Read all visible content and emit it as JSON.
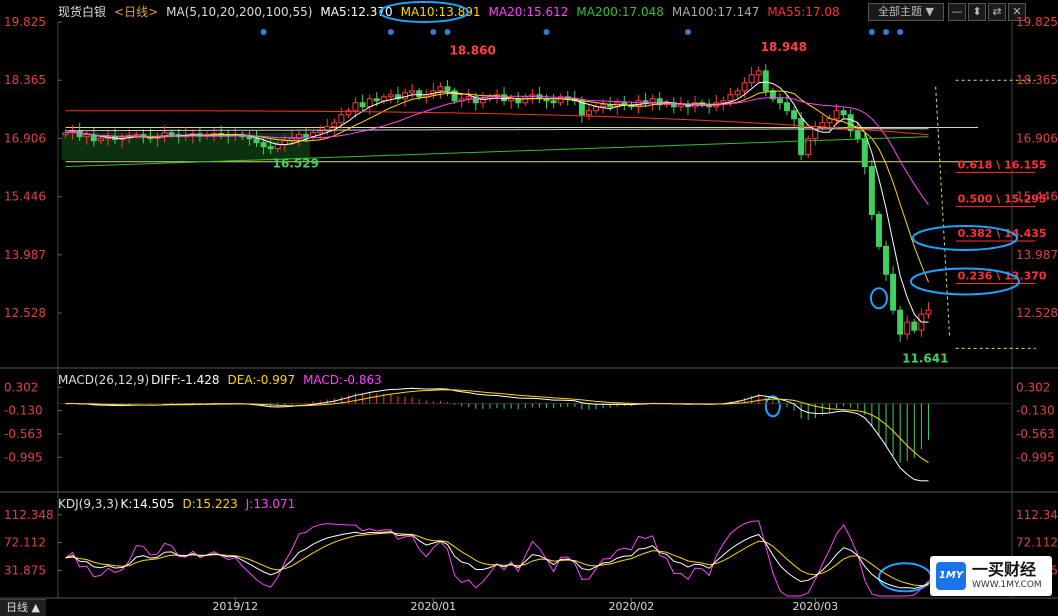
{
  "header": {
    "instrument": "现货白银",
    "period_tag": "<日线>",
    "ma_params": "MA(5,10,20,200,100,55)",
    "ma5": "MA5:12.370",
    "ma10": "MA10:13.891",
    "ma20": "MA20:15.612",
    "ma200": "MA200:17.048",
    "ma100": "MA100:17.147",
    "ma55": "MA55:17.08",
    "theme_label": "全部主题",
    "colors": {
      "ma5": "#ffffff",
      "ma10": "#ffd700",
      "ma20": "#ff40ff",
      "ma200": "#30c030",
      "ma100": "#cccccc",
      "ma55": "#ff3030"
    }
  },
  "macd_header": {
    "params": "MACD(26,12,9)",
    "diff": "DIFF:-1.428",
    "dea": "DEA:-0.997",
    "macd": "MACD:-0.863"
  },
  "kdj_header": {
    "params": "KDJ(9,3,3)",
    "k": "K:14.505",
    "d": "D:15.223",
    "j": "J:13.071"
  },
  "bottom_tab": "日线",
  "watermark": {
    "name": "一买财经",
    "url": "WWW.1MY.COM",
    "logo": "1MY"
  },
  "chart_data": [
    {
      "type": "candlestick",
      "title": "现货白银 日线",
      "y_ticks": [
        "19.825",
        "18.365",
        "16.906",
        "15.446",
        "13.987",
        "12.528"
      ],
      "y_tick_values": [
        19.825,
        18.365,
        16.906,
        15.446,
        13.987,
        12.528
      ],
      "ylim": [
        11.2,
        19.825
      ],
      "x_ticks": [
        "2019/12",
        "2020/01",
        "2020/02",
        "2020/03"
      ],
      "x_tick_index": [
        24,
        52,
        80,
        106
      ],
      "annotations": [
        {
          "text": "18.860",
          "index": 54,
          "value": 18.86,
          "color": "#ff4040"
        },
        {
          "text": "18.948",
          "index": 98,
          "value": 18.948,
          "color": "#ff4040"
        },
        {
          "text": "16.529",
          "index": 29,
          "value": 16.529,
          "color": "#40d060"
        },
        {
          "text": "11.641",
          "index": 118,
          "value": 11.641,
          "color": "#40d060"
        }
      ],
      "fib_levels": [
        {
          "label": "0.618 \\ 16.155",
          "value": 16.155
        },
        {
          "label": "0.500 \\ 15.295",
          "value": 15.295
        },
        {
          "label": "0.382 \\ 14.435",
          "value": 14.435
        },
        {
          "label": "0.236 \\ 13.370",
          "value": 13.37
        }
      ],
      "h_lines": [
        17.18,
        16.32
      ],
      "series": [
        {
          "name": "MA5",
          "color": "#ffffff"
        },
        {
          "name": "MA10",
          "color": "#ffd700"
        },
        {
          "name": "MA20",
          "color": "#ff40ff"
        },
        {
          "name": "MA200",
          "color": "#30c030"
        },
        {
          "name": "MA100",
          "color": "#cccccc"
        },
        {
          "name": "MA55",
          "color": "#ff3030"
        }
      ],
      "close": [
        17.05,
        17.1,
        16.95,
        17.0,
        16.85,
        16.9,
        16.95,
        16.88,
        16.92,
        16.98,
        17.0,
        16.95,
        16.9,
        16.95,
        17.05,
        17.0,
        16.95,
        16.98,
        17.02,
        16.96,
        17.0,
        17.03,
        17.0,
        16.98,
        17.0,
        16.95,
        16.9,
        16.8,
        16.7,
        16.65,
        16.75,
        16.85,
        16.9,
        17.0,
        16.95,
        17.05,
        17.1,
        17.2,
        17.3,
        17.5,
        17.6,
        17.8,
        17.7,
        17.9,
        17.85,
        17.95,
        18.0,
        17.9,
        18.05,
        18.1,
        17.95,
        18.0,
        18.1,
        18.2,
        18.1,
        17.85,
        17.9,
        17.95,
        17.8,
        17.9,
        17.95,
        18.0,
        17.85,
        17.9,
        17.8,
        17.95,
        18.0,
        17.9,
        17.85,
        17.8,
        17.95,
        17.9,
        17.85,
        17.5,
        17.6,
        17.7,
        17.75,
        17.7,
        17.8,
        17.75,
        17.7,
        17.85,
        17.8,
        17.9,
        17.75,
        17.8,
        17.7,
        17.75,
        17.7,
        17.8,
        17.75,
        17.7,
        17.8,
        17.85,
        18.0,
        18.1,
        18.3,
        18.5,
        18.6,
        18.1,
        17.9,
        17.8,
        17.6,
        17.4,
        16.5,
        16.9,
        17.2,
        17.3,
        17.4,
        17.6,
        17.5,
        17.1,
        16.9,
        16.2,
        15.0,
        14.2,
        13.5,
        12.6,
        12.0,
        12.3,
        12.1,
        12.5,
        12.6
      ],
      "ma_values": {
        "MA200": [
          16.2,
          16.95
        ],
        "MA100": [
          17.1,
          17.15
        ],
        "MA55": [
          17.6,
          17.0
        ]
      }
    },
    {
      "type": "line",
      "title": "MACD(26,12,9)",
      "y_ticks": [
        "0.302",
        "-0.130",
        "-0.563",
        "-0.995"
      ],
      "y_tick_values": [
        0.302,
        -0.13,
        -0.563,
        -0.995
      ],
      "ylim": [
        -1.6,
        0.4
      ],
      "series": [
        {
          "name": "DIFF",
          "color": "#ffffff",
          "last": -1.428
        },
        {
          "name": "DEA",
          "color": "#ffd700",
          "last": -0.997
        },
        {
          "name": "MACD",
          "color": "#ff40ff",
          "last": -0.863
        }
      ]
    },
    {
      "type": "line",
      "title": "KDJ(9,3,3)",
      "y_ticks": [
        "112.348",
        "72.112",
        "31.875"
      ],
      "y_tick_values": [
        112.348,
        72.112,
        31.875
      ],
      "ylim": [
        -5,
        125
      ],
      "series": [
        {
          "name": "K",
          "color": "#ffffff",
          "last": 14.505
        },
        {
          "name": "D",
          "color": "#ffd700",
          "last": 15.223
        },
        {
          "name": "J",
          "color": "#ff40ff",
          "last": 13.071
        }
      ]
    }
  ]
}
